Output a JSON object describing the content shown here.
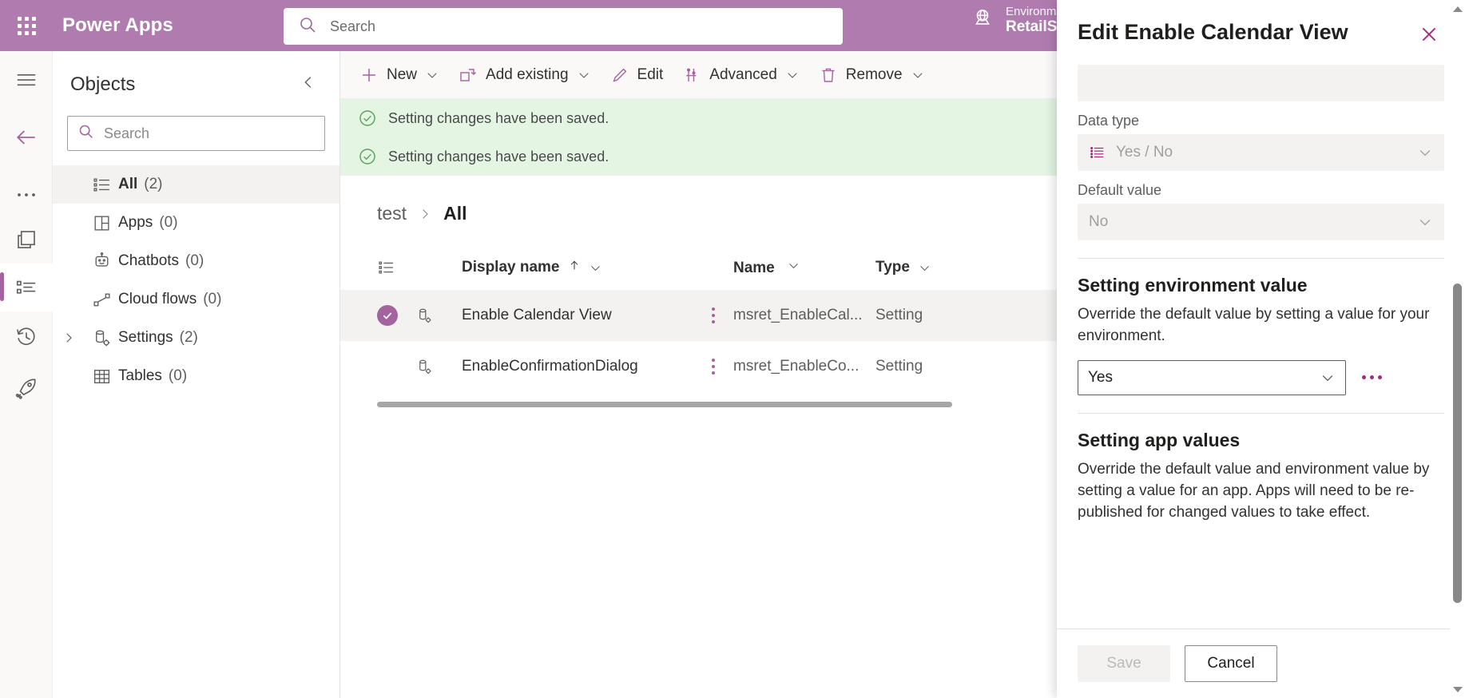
{
  "suite": {
    "brand": "Power Apps",
    "waffle_icon": "app-launcher-waffle-icon",
    "search": {
      "placeholder": "Search",
      "value": "",
      "icon": "search-icon"
    },
    "environment": {
      "label": "Environment",
      "name": "RetailSt",
      "icon": "globe-icon"
    }
  },
  "rail": {
    "items": [
      {
        "name": "hamburger-menu",
        "icon": "hamburger-icon"
      },
      {
        "name": "back",
        "icon": "arrow-left-icon"
      },
      {
        "name": "overflow",
        "icon": "ellipsis-icon"
      },
      {
        "name": "solutions",
        "icon": "solutions-icon"
      },
      {
        "name": "objects",
        "icon": "object-list-icon",
        "selected": true
      },
      {
        "name": "history",
        "icon": "history-clock-icon"
      },
      {
        "name": "publish",
        "icon": "rocket-icon"
      }
    ]
  },
  "objects": {
    "title": "Objects",
    "collapse_icon": "chevron-left-icon",
    "search": {
      "placeholder": "Search",
      "value": "",
      "icon": "search-icon"
    },
    "items": [
      {
        "label": "All",
        "count": "(2)",
        "icon": "list-icon",
        "selected": true,
        "expandable": false
      },
      {
        "label": "Apps",
        "count": "(0)",
        "icon": "apps-grid-icon",
        "selected": false,
        "expandable": false
      },
      {
        "label": "Chatbots",
        "count": "(0)",
        "icon": "chatbot-icon",
        "selected": false,
        "expandable": false
      },
      {
        "label": "Cloud flows",
        "count": "(0)",
        "icon": "cloud-flow-icon",
        "selected": false,
        "expandable": false
      },
      {
        "label": "Settings",
        "count": "(2)",
        "icon": "settings-db-icon",
        "selected": false,
        "expandable": true
      },
      {
        "label": "Tables",
        "count": "(0)",
        "icon": "table-icon",
        "selected": false,
        "expandable": false
      }
    ]
  },
  "commandbar": {
    "items": [
      {
        "label": "New",
        "icon": "plus-icon",
        "chevron": true
      },
      {
        "label": "Add existing",
        "icon": "add-existing-icon",
        "chevron": true
      },
      {
        "label": "Edit",
        "icon": "pencil-icon",
        "chevron": false
      },
      {
        "label": "Advanced",
        "icon": "advanced-icon",
        "chevron": true
      },
      {
        "label": "Remove",
        "icon": "trash-icon",
        "chevron": true
      }
    ]
  },
  "notifications": [
    {
      "text": "Setting changes have been saved.",
      "icon": "success-check-circle-icon"
    },
    {
      "text": "Setting changes have been saved.",
      "icon": "success-check-circle-icon"
    }
  ],
  "breadcrumb": {
    "parent": "test",
    "separator_icon": "chevron-right-icon",
    "current": "All"
  },
  "grid": {
    "columns": [
      {
        "key": "display_name",
        "label": "Display name",
        "sorted": true,
        "sort_icon": "arrow-up-icon",
        "chevron_icon": "chevron-down-icon"
      },
      {
        "key": "name",
        "label": "Name",
        "sorted": false,
        "chevron_icon": "chevron-down-icon"
      },
      {
        "key": "type",
        "label": "Type",
        "sorted": false,
        "chevron_icon": "chevron-down-icon"
      }
    ],
    "header_select_icon": "select-all-list-icon",
    "rows": [
      {
        "selected": true,
        "row_icon": "setting-definition-icon",
        "display_name": "Enable Calendar View",
        "name": "msret_EnableCal...",
        "type": "Setting",
        "kebab_icon": "more-vertical-icon",
        "check_icon": "checkmark-icon"
      },
      {
        "selected": false,
        "row_icon": "setting-definition-icon",
        "display_name": "EnableConfirmationDialog",
        "name": "msret_EnableCo...",
        "type": "Setting",
        "kebab_icon": "more-vertical-icon"
      }
    ]
  },
  "panel": {
    "title": "Edit Enable Calendar View",
    "close_icon": "close-x-icon",
    "description_field": {
      "value": ""
    },
    "data_type": {
      "label": "Data type",
      "value": "Yes / No",
      "icon": "choice-list-icon",
      "chevron_icon": "chevron-down-icon"
    },
    "default_value": {
      "label": "Default value",
      "value": "No",
      "chevron_icon": "chevron-down-icon"
    },
    "environment_section": {
      "title": "Setting environment value",
      "description": "Override the default value by setting a value for your environment.",
      "value": "Yes",
      "chevron_icon": "chevron-down-icon",
      "more_icon": "ellipsis-horizontal-icon"
    },
    "app_section": {
      "title": "Setting app values",
      "description": "Override the default value and environment value by setting a value for an app. Apps will need to be re-published for changed values to take effect."
    },
    "footer": {
      "save_label": "Save",
      "cancel_label": "Cancel"
    },
    "scrollbar": {
      "up_icon": "scroll-up-arrow-icon",
      "down_icon": "scroll-down-arrow-icon"
    }
  },
  "colors": {
    "brand_purple": "#b07cb0",
    "accent_purple": "#a4629f",
    "notification_green_bg": "#e4f5e4",
    "notification_green_fg": "#5aa05a",
    "selected_row_bg": "#f3f2f1"
  }
}
